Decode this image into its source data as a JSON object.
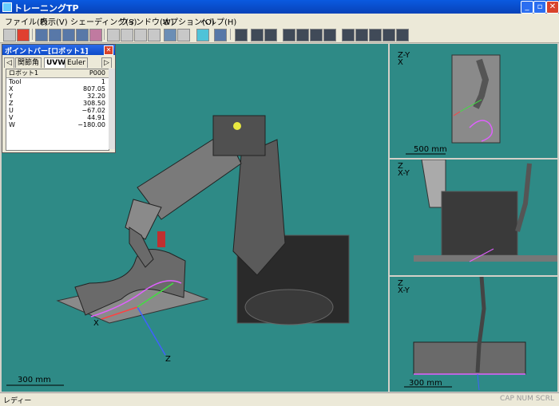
{
  "window": {
    "title": "トレーニングTP"
  },
  "menu": [
    "ファイル(F)",
    "表示(V)",
    "シェーディング(S)",
    "ウィンドウ(W)",
    "オプション(O)",
    "ヘルプ(H)"
  ],
  "pointbar": {
    "title": "ポイントバー[ロボット1]",
    "tabs": [
      "関節角",
      "UVW",
      "Euler"
    ],
    "header_left": "ロボット1",
    "header_right": "P000",
    "rows": [
      {
        "k": "Tool",
        "v": "1"
      },
      {
        "k": "X",
        "v": "807.05"
      },
      {
        "k": "Y",
        "v": "32.20"
      },
      {
        "k": "Z",
        "v": "308.50"
      },
      {
        "k": "U",
        "v": "−67.02"
      },
      {
        "k": "V",
        "v": "44.91"
      },
      {
        "k": "W",
        "v": "−180.00"
      }
    ]
  },
  "views": {
    "main_scale": "300 mm",
    "main_axis_z": "Z",
    "main_axis_x": "X",
    "top_scale": "500 mm",
    "bottom_scale": "300 mm",
    "top_axis": "Z-Y\nX",
    "mid_axis": "Z\nX-Y",
    "bot_axis": "Z\nX-Y"
  },
  "status": {
    "left": "レディー",
    "right": "CAP  NUM  SCRL"
  }
}
